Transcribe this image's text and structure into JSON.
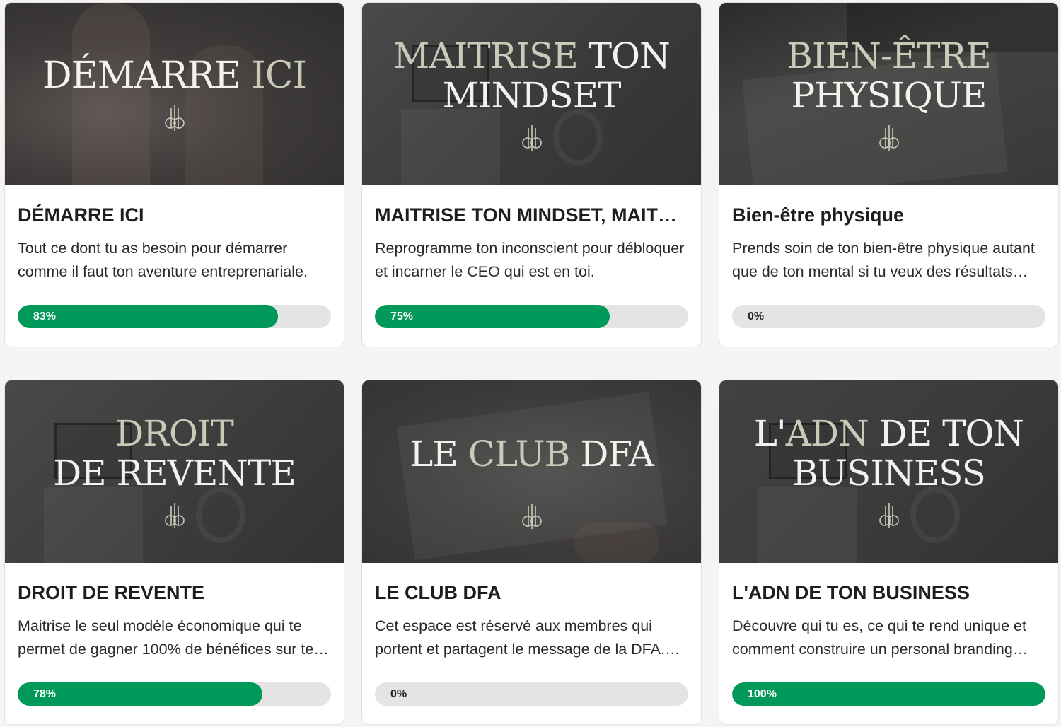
{
  "colors": {
    "progress_fill": "#00995a",
    "progress_track": "#e4e4e4",
    "page_bg": "#f5f4f2"
  },
  "courses": [
    {
      "cover": {
        "line1": "DÉMARRE",
        "line1_accent": "ICI",
        "line2": "",
        "line2_accent": ""
      },
      "title": "DÉMARRE ICI",
      "description": "Tout ce dont tu as besoin pour démarrer comme il faut ton aventure entreprenariale.",
      "progress": 83,
      "progress_label": "83%"
    },
    {
      "cover": {
        "line1": "",
        "line1_accent": "MAITRISE",
        "line1_rest": "TON",
        "line2": "MINDSET"
      },
      "title": "MAITRISE TON MINDSET, MAITRI...",
      "description": "Reprogramme ton inconscient pour débloquer et incarner le CEO qui est en toi.",
      "progress": 75,
      "progress_label": "75%"
    },
    {
      "cover": {
        "line1_accent": "BIEN-ÊTRE",
        "line2": "PHYSIQUE"
      },
      "title": "Bien-être physique",
      "description": "Prends soin de ton bien-être physique autant que de ton mental si tu veux des résultats…",
      "progress": 0,
      "progress_label": "0%"
    },
    {
      "cover": {
        "line1_accent": "DROIT",
        "line2": "DE REVENTE"
      },
      "title": "DROIT DE REVENTE",
      "description": "Maitrise le seul modèle économique qui te permet de gagner 100% de bénéfices sur te…",
      "progress": 78,
      "progress_label": "78%"
    },
    {
      "cover": {
        "line1": "LE",
        "line1_accent": "CLUB",
        "line1_rest": "DFA"
      },
      "title": "LE CLUB DFA",
      "description": "Cet espace est réservé aux membres qui portent et partagent le message de la DFA.…",
      "progress": 0,
      "progress_label": "0%"
    },
    {
      "cover": {
        "line1": "L'",
        "line1_accent": "ADN",
        "line1_rest": "DE TON",
        "line2": "BUSINESS"
      },
      "title": "L'ADN DE TON BUSINESS",
      "description": "Découvre qui tu es, ce qui te rend unique et comment construire un personal branding…",
      "progress": 100,
      "progress_label": "100%"
    }
  ]
}
